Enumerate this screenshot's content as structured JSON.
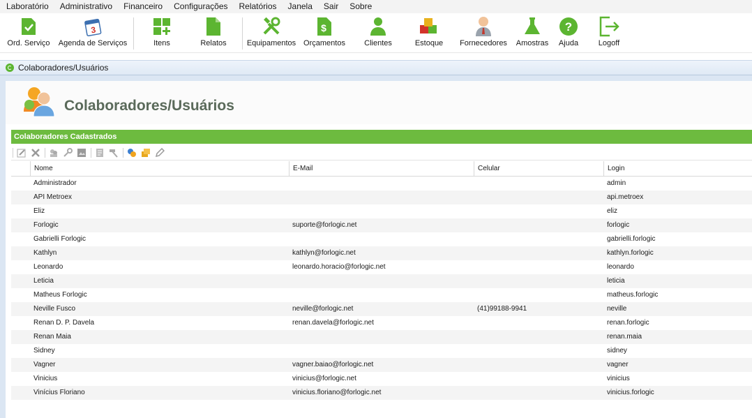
{
  "menu": [
    "Laboratório",
    "Administrativo",
    "Financeiro",
    "Configurações",
    "Relatórios",
    "Janela",
    "Sair",
    "Sobre"
  ],
  "toolbar": {
    "ord_servico": "Ord. Serviço",
    "agenda": "Agenda de Serviços",
    "agenda_day": "3",
    "itens": "Itens",
    "relatos": "Relatos",
    "equipamentos": "Equipamentos",
    "orcamentos": "Orçamentos",
    "orcamentos_symbol": "$",
    "clientes": "Clientes",
    "estoque": "Estoque",
    "fornecedores": "Fornecedores",
    "amostras": "Amostras",
    "ajuda": "Ajuda",
    "ajuda_symbol": "?",
    "logoff": "Logoff"
  },
  "location": {
    "breadcrumb": "Colaboradores/Usuários"
  },
  "page": {
    "title": "Colaboradores/Usuários",
    "section": "Colaboradores Cadastrados"
  },
  "grid": {
    "columns": {
      "nome": "Nome",
      "email": "E-Mail",
      "celular": "Celular",
      "login": "Login"
    },
    "rows": [
      {
        "nome": "Administrador",
        "email": "",
        "celular": "",
        "login": "admin"
      },
      {
        "nome": "API Metroex",
        "email": "",
        "celular": "",
        "login": "api.metroex"
      },
      {
        "nome": "Eliz",
        "email": "",
        "celular": "",
        "login": "eliz"
      },
      {
        "nome": "Forlogic",
        "email": "suporte@forlogic.net",
        "celular": "",
        "login": "forlogic"
      },
      {
        "nome": "Gabrielli Forlogic",
        "email": "",
        "celular": "",
        "login": "gabrielli.forlogic"
      },
      {
        "nome": "Kathlyn",
        "email": "kathlyn@forlogic.net",
        "celular": "",
        "login": "kathlyn.forlogic"
      },
      {
        "nome": "Leonardo",
        "email": "leonardo.horacio@forlogic.net",
        "celular": "",
        "login": "leonardo"
      },
      {
        "nome": "Leticia",
        "email": "",
        "celular": "",
        "login": "leticia"
      },
      {
        "nome": "Matheus Forlogic",
        "email": "",
        "celular": "",
        "login": "matheus.forlogic"
      },
      {
        "nome": "Neville Fusco",
        "email": "neville@forlogic.net",
        "celular": "(41)99188-9941",
        "login": "neville"
      },
      {
        "nome": "Renan D. P. Davela",
        "email": "renan.davela@forlogic.net",
        "celular": "",
        "login": "renan.forlogic"
      },
      {
        "nome": "Renan Maia",
        "email": "",
        "celular": "",
        "login": "renan.maia"
      },
      {
        "nome": "Sidney",
        "email": "",
        "celular": "",
        "login": "sidney"
      },
      {
        "nome": "Vagner",
        "email": "vagner.baiao@forlogic.net",
        "celular": "",
        "login": "vagner"
      },
      {
        "nome": "Vinicius",
        "email": "vinicius@forlogic.net",
        "celular": "",
        "login": "vinicius"
      },
      {
        "nome": "Vinícius Floriano",
        "email": "vinicius.floriano@forlogic.net",
        "celular": "",
        "login": "vinicius.forlogic"
      }
    ]
  },
  "colors": {
    "accent_green": "#6dbb3f",
    "icon_green": "#5cb531",
    "title_gray": "#5a6a5a"
  }
}
